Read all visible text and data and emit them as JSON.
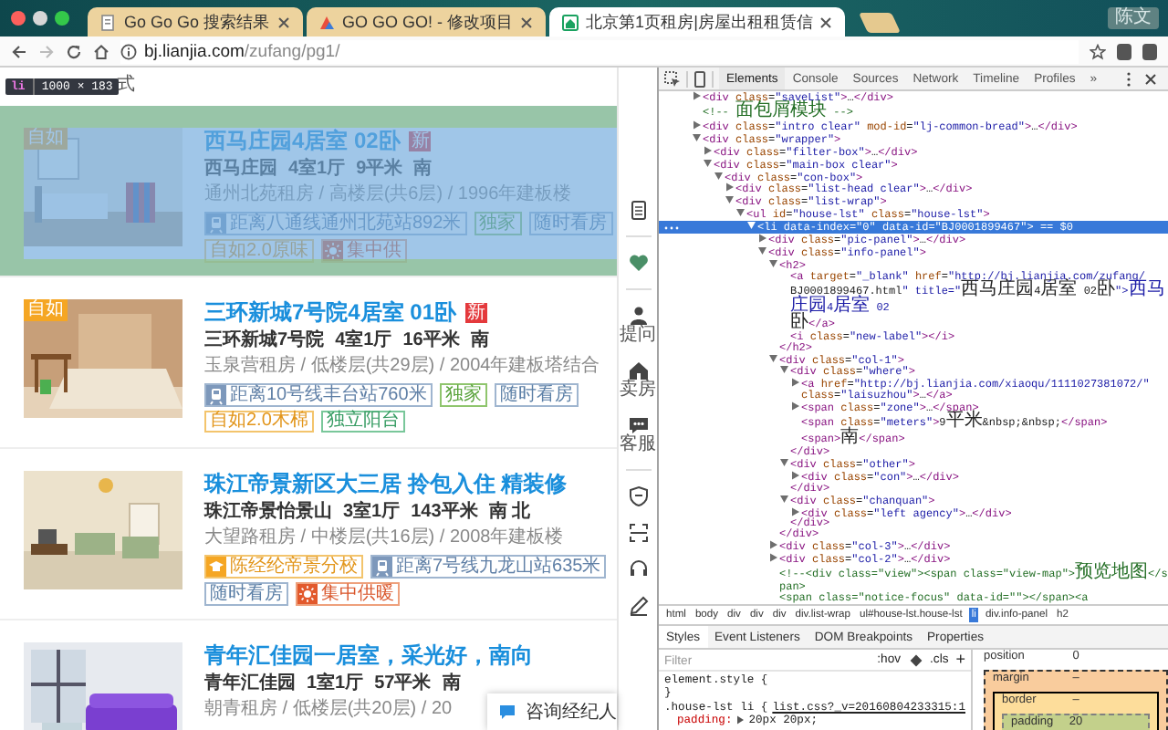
{
  "browser": {
    "tabs": [
      {
        "title": "Go Go Go 搜索结果",
        "selected": false
      },
      {
        "title": "GO GO GO! - 修改项目",
        "selected": false
      },
      {
        "title": "北京第1页租房|房屋出租租赁信",
        "selected": true
      }
    ],
    "profile": "陈文",
    "url": {
      "host": "bj.lianjia.com",
      "path": "/zufang/pg1/"
    }
  },
  "page": {
    "breadcrumb": "式",
    "inspect_tooltip": {
      "tag": "li",
      "size": "1000 × 183"
    },
    "listings": [
      {
        "title": "西马庄园4居室 02卧",
        "new_badge": "新",
        "photo_label": "自如",
        "highlighted": true,
        "community": "西马庄园",
        "layout": "4室1厅",
        "area": "9平米",
        "facing": "南",
        "details": "通州北苑租房 / 高楼层(共6层) / 1996年建板楼",
        "tags": [
          {
            "kind": "subway",
            "text": "距离八通线通州北苑站892米"
          },
          {
            "kind": "exclusive",
            "text": "独家"
          },
          {
            "kind": "viewing",
            "text": "随时看房"
          },
          {
            "kind": "ziroom",
            "text": "自如2.0原味"
          },
          {
            "kind": "heating",
            "text": "集中供"
          }
        ]
      },
      {
        "title": "三环新城7号院4居室 01卧",
        "new_badge": "新",
        "photo_label": "自如",
        "highlighted": false,
        "community": "三环新城7号院",
        "layout": "4室1厅",
        "area": "16平米",
        "facing": "南",
        "details": "玉泉营租房 / 低楼层(共29层) / 2004年建板塔结合",
        "tags": [
          {
            "kind": "subway",
            "text": "距离10号线丰台站760米"
          },
          {
            "kind": "exclusive",
            "text": "独家"
          },
          {
            "kind": "viewing",
            "text": "随时看房"
          },
          {
            "kind": "ziroom",
            "text": "自如2.0木棉"
          },
          {
            "kind": "balcony",
            "text": "独立阳台"
          }
        ]
      },
      {
        "title": "珠江帝景新区大三居 拎包入住 精装修",
        "highlighted": false,
        "community": "珠江帝景怡景山",
        "layout": "3室1厅",
        "area": "143平米",
        "facing": "南 北",
        "details": "大望路租房 / 中楼层(共16层) / 2008年建板楼",
        "tags": [
          {
            "kind": "school",
            "text": "陈经纶帝景分校"
          },
          {
            "kind": "subway",
            "text": "距离7号线九龙山站635米"
          },
          {
            "kind": "viewing",
            "text": "随时看房"
          },
          {
            "kind": "heating",
            "text": "集中供暖"
          }
        ]
      },
      {
        "title": "青年汇佳园一居室，采光好，南向",
        "highlighted": false,
        "community": "青年汇佳园",
        "layout": "1室1厅",
        "area": "57平米",
        "facing": "南",
        "details": "朝青租房 / 低楼层(共20层) / 20"
      }
    ],
    "sidebar_labels": [
      "提问",
      "卖房",
      "客服"
    ],
    "consult": "咨询经纪人"
  },
  "devtools": {
    "tabs": [
      {
        "label": "Elements",
        "selected": true
      },
      {
        "label": "Console",
        "selected": false
      },
      {
        "label": "Sources",
        "selected": false
      },
      {
        "label": "Network",
        "selected": false
      },
      {
        "label": "Timeline",
        "selected": false
      },
      {
        "label": "Profiles",
        "selected": false
      }
    ],
    "overflow": "»",
    "dom_tree": [
      {
        "kind": "element",
        "lines": [
          "<div class=\"saveList\">…</div>"
        ],
        "expanded": false,
        "selected": false
      },
      {
        "kind": "comment",
        "lines": [
          "<!-- 面包屑模块 -->"
        ],
        "selected": false
      },
      {
        "kind": "element",
        "lines": [
          "<div class=\"intro clear\" mod-id=\"lj-common-bread\">…</div>"
        ],
        "expanded": false,
        "selected": false
      },
      {
        "kind": "element",
        "lines": [
          "<div class=\"wrapper\">"
        ],
        "expanded": true,
        "selected": false,
        "children": [
          {
            "kind": "element",
            "lines": [
              "<div class=\"filter-box\">…</div>"
            ],
            "expanded": false,
            "selected": false
          },
          {
            "kind": "element",
            "lines": [
              "<div class=\"main-box clear\">"
            ],
            "expanded": true,
            "selected": false,
            "children": [
              {
                "kind": "element",
                "lines": [
                  "<div class=\"con-box\">"
                ],
                "expanded": true,
                "selected": false,
                "children": [
                  {
                    "kind": "element",
                    "lines": [
                      "<div class=\"list-head clear\">…</div>"
                    ],
                    "expanded": false,
                    "selected": false
                  },
                  {
                    "kind": "element",
                    "lines": [
                      "<div class=\"list-wrap\">"
                    ],
                    "expanded": true,
                    "selected": false,
                    "children": [
                      {
                        "kind": "element",
                        "lines": [
                          "<ul id=\"house-lst\" class=\"house-lst\">"
                        ],
                        "expanded": true,
                        "selected": false,
                        "children": [
                          {
                            "kind": "element",
                            "lines": [
                              "<li data-index=\"0\" data-id=\"BJ0001899467\">"
                            ],
                            "suffix": "== $0",
                            "expanded": true,
                            "selected": true,
                            "children": [
                              {
                                "kind": "element",
                                "lines": [
                                  "<div class=\"pic-panel\">…</div>"
                                ],
                                "expanded": false,
                                "selected": false
                              },
                              {
                                "kind": "element",
                                "lines": [
                                  "<div class=\"info-panel\">"
                                ],
                                "expanded": true,
                                "selected": false,
                                "children": [
                                  {
                                    "kind": "element",
                                    "lines": [
                                      "<h2>"
                                    ],
                                    "expanded": true,
                                    "selected": false,
                                    "close": "</h2>",
                                    "children": [
                                      {
                                        "kind": "leaf",
                                        "lines": [
                                          "<a target=\"_blank\" href=\"http://bj.lianjia.com/zufang/",
                                          "BJ0001899467.html\" title=\"西马庄园4居室 02卧\">西马庄园4居室 02",
                                          "卧</a>"
                                        ],
                                        "selected": false
                                      },
                                      {
                                        "kind": "leaf",
                                        "lines": [
                                          "<i class=\"new-label\"></i>"
                                        ],
                                        "selected": false
                                      }
                                    ]
                                  },
                                  {
                                    "kind": "element",
                                    "lines": [
                                      "<div class=\"col-1\">"
                                    ],
                                    "expanded": true,
                                    "selected": false,
                                    "close": "</div>",
                                    "children": [
                                      {
                                        "kind": "element",
                                        "lines": [
                                          "<div class=\"where\">"
                                        ],
                                        "expanded": true,
                                        "selected": false,
                                        "close": "</div>",
                                        "children": [
                                          {
                                            "kind": "element",
                                            "lines": [
                                              "<a href=\"http://bj.lianjia.com/xiaoqu/1111027381072/\"",
                                              "class=\"laisuzhou\">…</a>"
                                            ],
                                            "expanded": false,
                                            "selected": false
                                          },
                                          {
                                            "kind": "element",
                                            "lines": [
                                              "<span class=\"zone\">…</span>"
                                            ],
                                            "expanded": false,
                                            "selected": false
                                          },
                                          {
                                            "kind": "leaf",
                                            "lines": [
                                              "<span class=\"meters\">9平米&nbsp;&nbsp;</span>"
                                            ],
                                            "selected": false
                                          },
                                          {
                                            "kind": "leaf",
                                            "lines": [
                                              "<span>南</span>"
                                            ],
                                            "selected": false
                                          }
                                        ]
                                      },
                                      {
                                        "kind": "element",
                                        "lines": [
                                          "<div class=\"other\">"
                                        ],
                                        "expanded": true,
                                        "selected": false,
                                        "close": "</div>",
                                        "children": [
                                          {
                                            "kind": "element",
                                            "lines": [
                                              "<div class=\"con\">…</div>"
                                            ],
                                            "expanded": false,
                                            "selected": false
                                          }
                                        ]
                                      },
                                      {
                                        "kind": "element",
                                        "lines": [
                                          "<div class=\"chanquan\">"
                                        ],
                                        "expanded": true,
                                        "selected": false,
                                        "close": "</div>",
                                        "children": [
                                          {
                                            "kind": "element",
                                            "lines": [
                                              "<div class=\"left agency\">…</div>"
                                            ],
                                            "expanded": false,
                                            "selected": false
                                          }
                                        ]
                                      }
                                    ]
                                  },
                                  {
                                    "kind": "element",
                                    "lines": [
                                      "<div class=\"col-3\">…</div>"
                                    ],
                                    "expanded": false,
                                    "selected": false
                                  },
                                  {
                                    "kind": "element",
                                    "lines": [
                                      "<div class=\"col-2\">…</div>"
                                    ],
                                    "expanded": false,
                                    "selected": false
                                  },
                                  {
                                    "kind": "comment",
                                    "lines": [
                                      "<!--<div class=\"view\"><span class=\"view-map\">预览地图</span>",
                                      "<span class=\"notice-focus\" data-id=\"\"></span><a"
                                    ],
                                    "selected": false
                                  }
                                ]
                              }
                            ]
                          }
                        ]
                      }
                    ]
                  }
                ]
              }
            ]
          }
        ]
      }
    ],
    "breadcrumbs": [
      {
        "label": "html",
        "selected": false
      },
      {
        "label": "body",
        "selected": false
      },
      {
        "label": "div",
        "selected": false
      },
      {
        "label": "div",
        "selected": false
      },
      {
        "label": "div",
        "selected": false
      },
      {
        "label": "div.list-wrap",
        "selected": false
      },
      {
        "label": "ul#house-lst.house-lst",
        "selected": false
      },
      {
        "label": "li",
        "selected": true
      },
      {
        "label": "div.info-panel",
        "selected": false
      },
      {
        "label": "h2",
        "selected": false
      }
    ],
    "pane_tabs": [
      {
        "label": "Styles",
        "selected": true
      },
      {
        "label": "Event Listeners",
        "selected": false
      },
      {
        "label": "DOM Breakpoints",
        "selected": false
      },
      {
        "label": "Properties",
        "selected": false
      }
    ],
    "styles": {
      "filter_placeholder": "Filter",
      "hov": ":hov",
      "cls": ".cls",
      "add": "+",
      "rules": [
        {
          "selector": "element.style {",
          "close": "}"
        },
        {
          "selector": ".house-lst li {",
          "source": "list.css?_v=20160804233315:1",
          "declarations": [
            {
              "property": "padding:",
              "value": "20px 20px;",
              "expandable": true
            }
          ]
        }
      ]
    },
    "box_model": [
      {
        "label": "position",
        "value": "0"
      },
      {
        "label": "margin",
        "value": "–"
      },
      {
        "label": "border",
        "value": "–"
      },
      {
        "label": "padding",
        "value": "20"
      }
    ]
  }
}
